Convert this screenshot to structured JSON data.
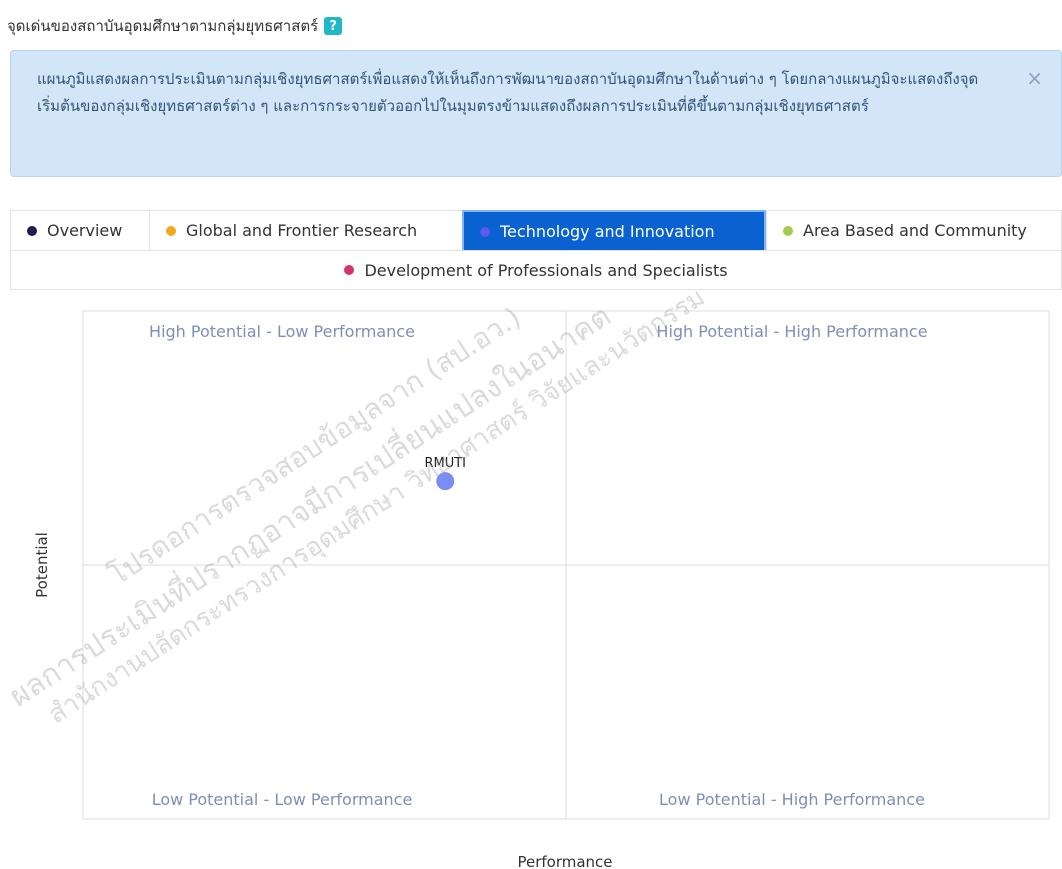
{
  "header": {
    "title": "จุดเด่นของสถาบันอุดมศึกษาตามกลุ่มยุทธศาสตร์",
    "help_icon": "?"
  },
  "alert": {
    "text": "แผนภูมิแสดงผลการประเมินตามกลุ่มเชิงยุทธศาสตร์เพื่อแสดงให้เห็นถึงการพัฒนาของสถาบันอุดมศึกษาในด้านต่าง ๆ โดยกลางแผนภูมิจะแสดงถึงจุดเริ่มต้นของกลุ่มเชิงยุทธศาสตร์ต่าง ๆ และการกระจายตัวออกไปในมุมตรงข้ามแสดงถึงผลการประเมินที่ดีขึ้นตามกลุ่มเชิงยุทธศาสตร์",
    "close_icon": "×"
  },
  "tabs": [
    {
      "label": "Overview",
      "color": "#1f1b4d",
      "active": false
    },
    {
      "label": "Global and Frontier Research",
      "color": "#f5a623",
      "active": false
    },
    {
      "label": "Technology and Innovation",
      "color": "#5b5bf0",
      "active": true
    },
    {
      "label": "Area Based and Community",
      "color": "#a9c94a",
      "active": false
    },
    {
      "label": "Development of Professionals and Specialists",
      "color": "#d6336c",
      "active": false
    }
  ],
  "watermark": {
    "lines": [
      "ผลการประเมินที่ปรากฏอาจมีการเปลี่ยนแปลงในอนาคต",
      "โปรดอการตรวจสอบข้อมูลจาก (สป.อว.)",
      "สำนักงานปลัดกระทรวงการอุดมศึกษา วิทยาศาสตร์ วิจัยและนวัตกรรม"
    ]
  },
  "chart_data": {
    "type": "scatter",
    "title": "",
    "xlabel": "Performance",
    "ylabel": "Potential",
    "xlim": [
      0,
      1
    ],
    "ylim": [
      0,
      1
    ],
    "quadrants": {
      "top_left": "High Potential - Low Performance",
      "top_right": "High Potential - High Performance",
      "bottom_left": "Low Potential - Low Performance",
      "bottom_right": "Low Potential - High Performance"
    },
    "points": [
      {
        "label": "RMUTI",
        "x": 0.375,
        "y": 0.665,
        "color": "#7b8cf5"
      }
    ]
  }
}
